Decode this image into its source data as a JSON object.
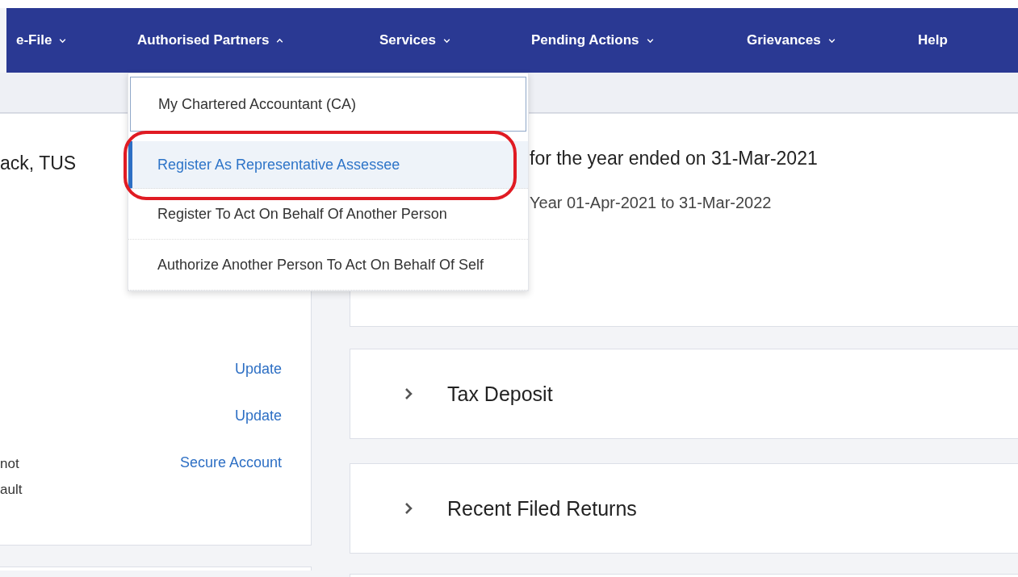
{
  "nav": [
    {
      "label": "e-File",
      "kind": "dropdown",
      "expanded": false
    },
    {
      "label": "Authorised Partners",
      "kind": "dropdown",
      "expanded": true
    },
    {
      "label": "Services",
      "kind": "dropdown",
      "expanded": false
    },
    {
      "label": "Pending Actions",
      "kind": "dropdown",
      "expanded": false
    },
    {
      "label": "Grievances",
      "kind": "dropdown",
      "expanded": false
    },
    {
      "label": "Help",
      "kind": "link"
    }
  ],
  "menu": {
    "items": [
      {
        "label": "My Chartered Accountant (CA)",
        "selected": false,
        "focused": true,
        "annotated": false
      },
      {
        "label": "Register As Representative Assessee",
        "selected": true,
        "focused": false,
        "annotated": true
      },
      {
        "label": "Register To Act On Behalf Of Another Person",
        "selected": false,
        "focused": false,
        "annotated": false
      },
      {
        "label": "Authorize Another Person To Act On Behalf Of Self",
        "selected": false,
        "focused": false,
        "annotated": false
      }
    ]
  },
  "profile": {
    "greeting": "ack, TUS",
    "rows": [
      {
        "link": "Update"
      },
      {
        "link": "Update"
      },
      {
        "text": "not ault",
        "link": "Secure Account"
      }
    ]
  },
  "summary": {
    "heading": "for the year ended on 31-Mar-2021",
    "subheading": "Year 01-Apr-2021 to 31-Mar-2022"
  },
  "panels": [
    {
      "title": "Tax Deposit",
      "expanded": false
    },
    {
      "title": "Recent Filed Returns",
      "expanded": false
    }
  ]
}
